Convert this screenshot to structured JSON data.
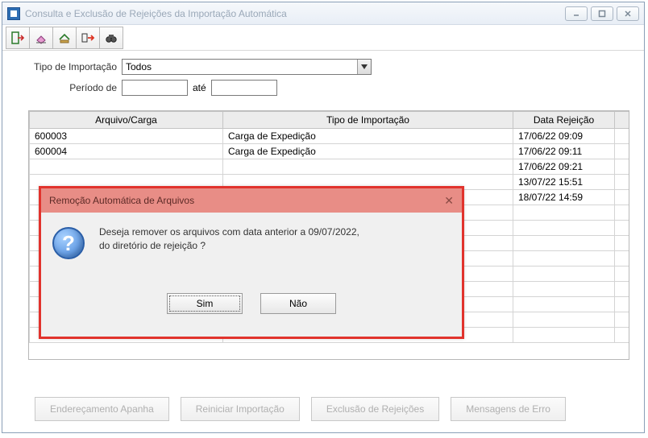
{
  "window": {
    "title": "Consulta e Exclusão de Rejeições da Importação Automática"
  },
  "form": {
    "tipo_label": "Tipo de Importação",
    "tipo_value": "Todos",
    "periodo_label": "Período de",
    "periodo_from": "",
    "ate_label": "até",
    "periodo_to": ""
  },
  "grid": {
    "headers": {
      "arquivo": "Arquivo/Carga",
      "tipo": "Tipo de Importação",
      "data": "Data Rejeição"
    },
    "rows": [
      {
        "arquivo": "600003",
        "tipo": "Carga de Expedição",
        "data": "17/06/22  09:09"
      },
      {
        "arquivo": "600004",
        "tipo": "Carga de Expedição",
        "data": "17/06/22  09:11"
      },
      {
        "arquivo": "",
        "tipo": "",
        "data": "17/06/22  09:21"
      },
      {
        "arquivo": "",
        "tipo": "",
        "data": "13/07/22  15:51"
      },
      {
        "arquivo": "",
        "tipo": "",
        "data": "18/07/22  14:59"
      }
    ]
  },
  "footer": {
    "enderecamento": "Endereçamento Apanha",
    "reiniciar": "Reiniciar Importação",
    "exclusao": "Exclusão de Rejeições",
    "mensagens": "Mensagens de Erro"
  },
  "dialog": {
    "title": "Remoção Automática de Arquivos",
    "line1": "Deseja remover os arquivos com data anterior a 09/07/2022,",
    "line2": "do diretório de rejeição ?",
    "yes": "Sim",
    "no": "Não"
  },
  "icons": {
    "toolbar": [
      "exit-icon",
      "eraser-icon",
      "save-icon",
      "export-icon",
      "binoculars-icon"
    ]
  }
}
